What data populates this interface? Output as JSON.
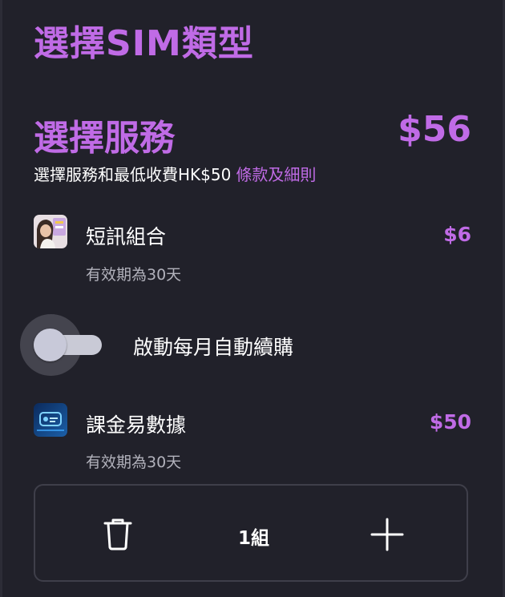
{
  "page": {
    "title": "選擇SIM類型"
  },
  "service_section": {
    "title": "選擇服務",
    "total_price": "$56",
    "min_charge_text": "選擇服務和最低收費HK$50",
    "terms_link": "條款及細則"
  },
  "services": [
    {
      "name": "短訊組合",
      "price": "$6",
      "validity": "有效期為30天",
      "icon": "sms-bundle-thumbnail"
    },
    {
      "name": "課金易數據",
      "price": "$50",
      "validity": "有效期為30天",
      "icon": "data-bundle-thumbnail"
    }
  ],
  "auto_renew": {
    "label": "啟動每月自動續購",
    "enabled": false
  },
  "quantity": {
    "value": "1組"
  },
  "colors": {
    "accent": "#c06be6",
    "background": "#21212a",
    "muted_text": "#b2b2bc",
    "border": "#3f3f4a"
  }
}
